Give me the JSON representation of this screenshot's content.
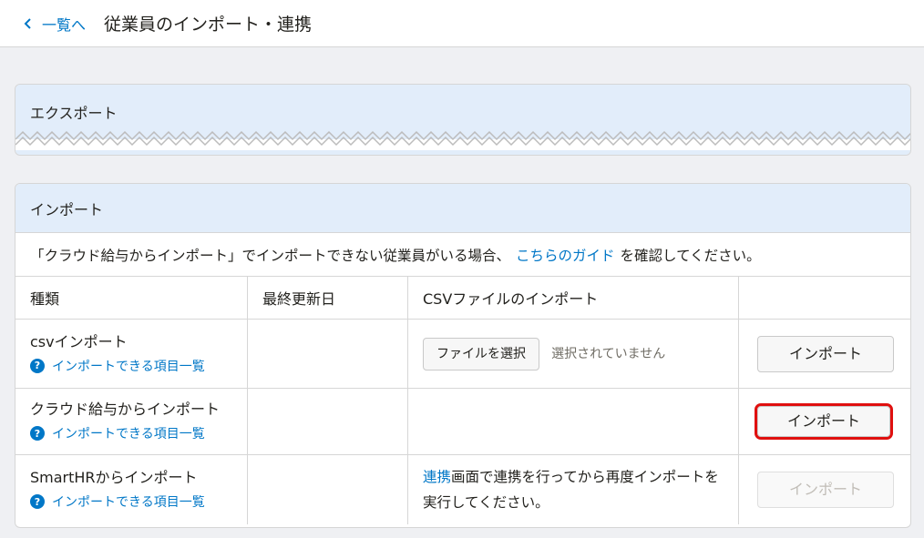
{
  "header": {
    "back_label": "一覧へ",
    "title": "従業員のインポート・連携"
  },
  "export_panel": {
    "title": "エクスポート"
  },
  "import_panel": {
    "title": "インポート",
    "notice_before": "「クラウド給与からインポート」でインポートできない従業員がいる場合、",
    "notice_link": "こちらのガイド",
    "notice_after": "を確認してください。",
    "columns": [
      "種類",
      "最終更新日",
      "CSVファイルのインポート",
      ""
    ],
    "rows": [
      {
        "type": "csvインポート",
        "help": "インポートできる項目一覧",
        "last_updated": "",
        "file_button": "ファイルを選択",
        "file_status": "選択されていません",
        "import_label": "インポート"
      },
      {
        "type": "クラウド給与からインポート",
        "help": "インポートできる項目一覧",
        "last_updated": "",
        "import_label": "インポート"
      },
      {
        "type": "SmartHRからインポート",
        "help": "インポートできる項目一覧",
        "last_updated": "",
        "sync_link": "連携",
        "sync_text": "画面で連携を行ってから再度インポートを実行してください。",
        "import_label": "インポート"
      }
    ]
  },
  "colors": {
    "accent": "#0077c7",
    "header_bg": "#e2edfa",
    "highlight": "#e0100f"
  }
}
